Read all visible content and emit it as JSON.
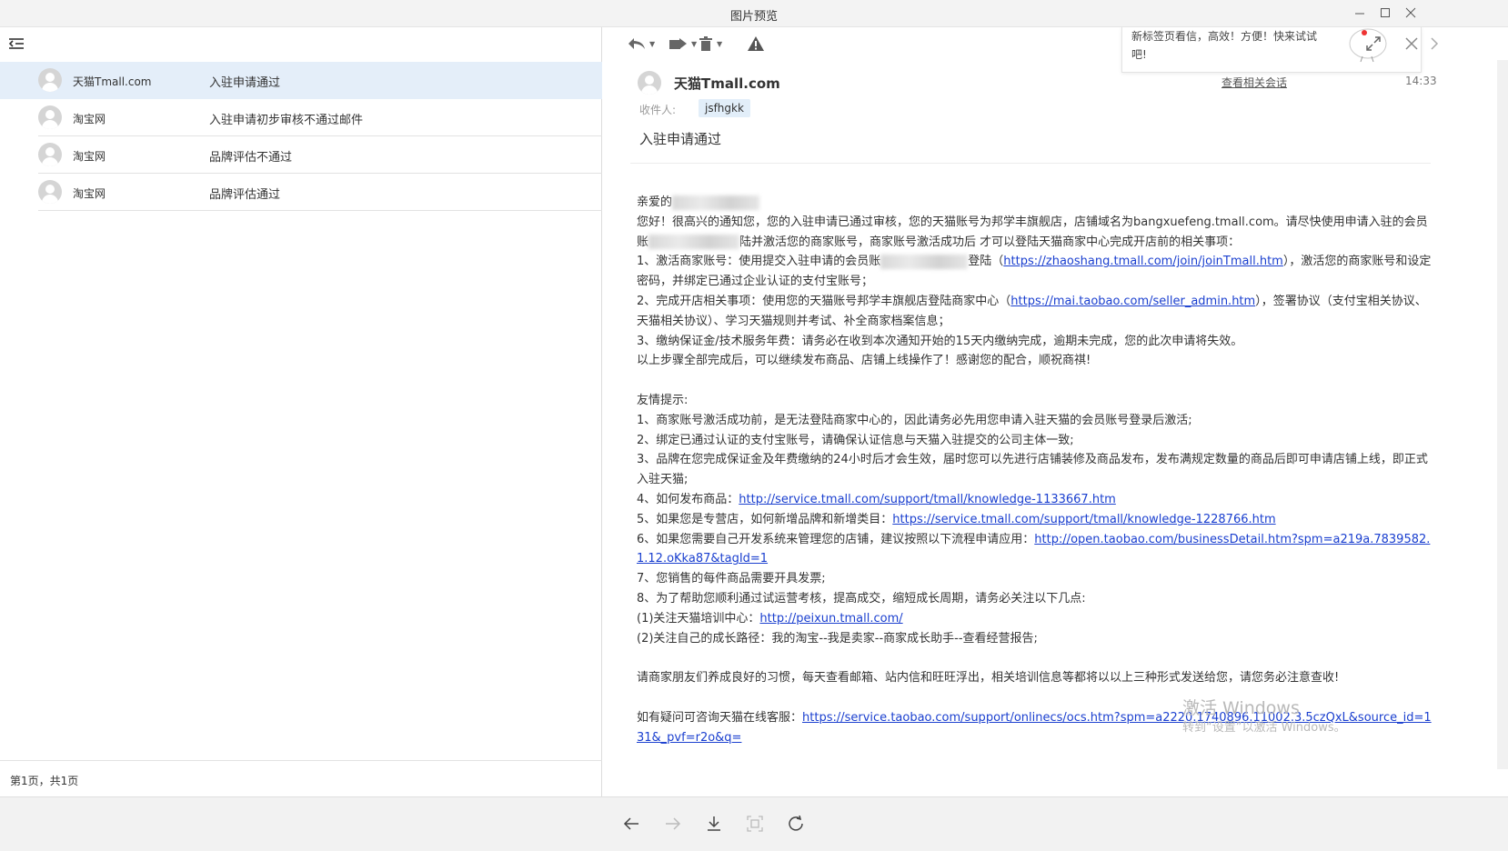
{
  "window": {
    "title": "图片预览"
  },
  "mail_list": {
    "items": [
      {
        "sender": "天猫Tmall.com",
        "subject": "入驻申请通过",
        "selected": true
      },
      {
        "sender": "淘宝网",
        "subject": "入驻申请初步审核不通过邮件",
        "selected": false
      },
      {
        "sender": "淘宝网",
        "subject": "品牌评估不通过",
        "selected": false
      },
      {
        "sender": "淘宝网",
        "subject": "品牌评估通过",
        "selected": false
      }
    ],
    "pagination": "第1页，共1页"
  },
  "popup": {
    "text": "新标签页看信，高效！方便！快来试试吧!"
  },
  "mail": {
    "sender": "天猫Tmall.com",
    "related_link": "查看相关会话",
    "time": "14:33",
    "to_label": "收件人:",
    "to_value": "jsfhgkk",
    "subject": "入驻申请通过",
    "greeting": "亲爱的",
    "p1": "您好！很高兴的通知您，您的入驻申请已通过审核，您的天猫账号为邦学丰旗舰店，店铺域名为bangxuefeng.tmall.com。请尽快使用申请入驻的会员账",
    "p1b": "陆并激活您的商家账号，商家账号激活成功后 才可以登陆天猫商家中心完成开店前的相关事项：",
    "s1a": "1、激活商家账号：使用提交入驻申请的会员账",
    "s1b": "登陆（",
    "s1_link": "https://zhaoshang.tmall.com/join/joinTmall.htm",
    "s1c": "），激活您的商家账号和设定密码，并绑定已通过企业认证的支付宝账号；",
    "s2a": "2、完成开店相关事项：使用您的天猫账号邦学丰旗舰店登陆商家中心（",
    "s2_link": "https://mai.taobao.com/seller_admin.htm",
    "s2b": "），签署协议（支付宝相关协议、天猫相关协议）、学习天猫规则并考试、补全商家档案信息；",
    "s3": "3、缴纳保证金/技术服务年费：请务必在收到本次通知开始的15天内缴纳完成，逾期未完成，您的此次申请将失效。",
    "s4": "以上步骤全部完成后，可以继续发布商品、店铺上线操作了！感谢您的配合，顺祝商祺!",
    "tips_title": "友情提示:",
    "t1": "1、商家账号激活成功前，是无法登陆商家中心的，因此请务必先用您申请入驻天猫的会员账号登录后激活;",
    "t2": "2、绑定已通过认证的支付宝账号，请确保认证信息与天猫入驻提交的公司主体一致;",
    "t3": "3、品牌在您完成保证金及年费缴纳的24小时后才会生效，届时您可以先进行店铺装修及商品发布，发布满规定数量的商品后即可申请店铺上线，即正式入驻天猫;",
    "t4a": "4、如何发布商品：",
    "t4_link": "http://service.tmall.com/support/tmall/knowledge-1133667.htm",
    "t5a": "5、如果您是专营店，如何新增品牌和新增类目：",
    "t5_link": "https://service.tmall.com/support/tmall/knowledge-1228766.htm",
    "t6a": "6、如果您需要自己开发系统来管理您的店铺，建议按照以下流程申请应用：",
    "t6_link": "http://open.taobao.com/businessDetail.htm?spm=a219a.7839582.1.12.oKka87&tagId=1",
    "t7": "7、您销售的每件商品需要开具发票;",
    "t8": "8、为了帮助您顺利通过试运营考核，提高成交，缩短成长周期，请务必关注以下几点:",
    "t8_1a": "(1)关注天猫培训中心：",
    "t8_1_link": "http://peixun.tmall.com/",
    "t8_2": "(2)关注自己的成长路径：我的淘宝--我是卖家--商家成长助手--查看经营报告;",
    "notice": "请商家朋友们养成良好的习惯，每天查看邮箱、站内信和旺旺浮出，相关培训信息等都将以以上三种形式发送给您，请您务必注意查收!",
    "contact_a": "如有疑问可咨询天猫在线客服：",
    "contact_link": "https://service.taobao.com/support/onlinecs/ocs.htm?spm=a2220.1740896.11002.3.5czQxL&source_id=131&_pvf=r2o&q="
  },
  "watermark": {
    "line1": "激活 Windows",
    "line2": "转到“设置”以激活 Windows。"
  },
  "icons": {
    "toolbar": [
      "reply-icon",
      "forward-icon",
      "delete-icon",
      "warning-icon",
      "expand-icon",
      "close-icon"
    ],
    "bottom": [
      "back-icon",
      "forward-nav-icon",
      "download-icon",
      "fit-icon",
      "rotate-icon"
    ]
  },
  "colors": {
    "link": "#1a3fcf",
    "selected_row": "#e4eef9",
    "chip": "#e2eef9"
  }
}
